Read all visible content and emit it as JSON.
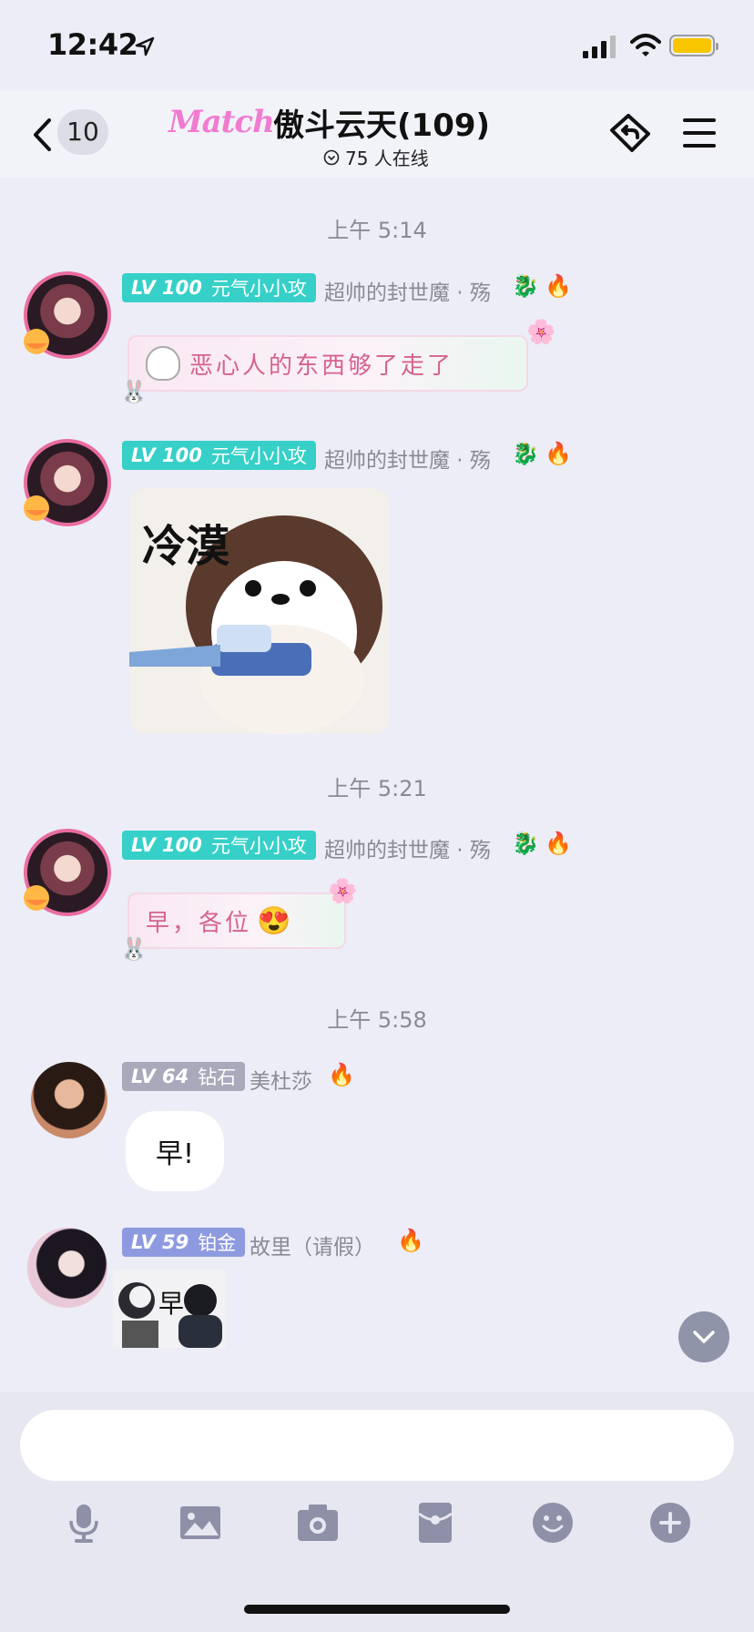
{
  "status_bar": {
    "time": "12:42"
  },
  "header": {
    "unread_count": "10",
    "logo_text": "Match",
    "title": "傲斗云天(109)",
    "online_text": "75 人在线"
  },
  "timestamps": [
    "上午 5:14",
    "上午 5:21",
    "上午 5:58"
  ],
  "messages": [
    {
      "level": "LV 100",
      "rank": "元气小小攻",
      "sender": "超帅的封世魔 · 殇",
      "text": "恶心人的东西够了走了"
    },
    {
      "level": "LV 100",
      "rank": "元气小小攻",
      "sender": "超帅的封世魔 · 殇",
      "sticker_text": "冷漠"
    },
    {
      "level": "LV 100",
      "rank": "元气小小攻",
      "sender": "超帅的封世魔 · 殇",
      "text": "早，各位"
    },
    {
      "level": "LV 64",
      "rank": "钻石",
      "sender": "美杜莎",
      "text": "早!"
    },
    {
      "level": "LV 59",
      "rank": "铂金",
      "sender": "故里（请假）",
      "sticker_text": "早"
    }
  ],
  "colors": {
    "teal_badge": "#36d0c8",
    "gray_badge": "#a8aabb",
    "blue_badge": "#8e9ae0",
    "deco_text": "#d6628f"
  },
  "toolbar": [
    "microphone-icon",
    "image-icon",
    "camera-icon",
    "red-packet-icon",
    "emoji-icon",
    "plus-icon"
  ]
}
